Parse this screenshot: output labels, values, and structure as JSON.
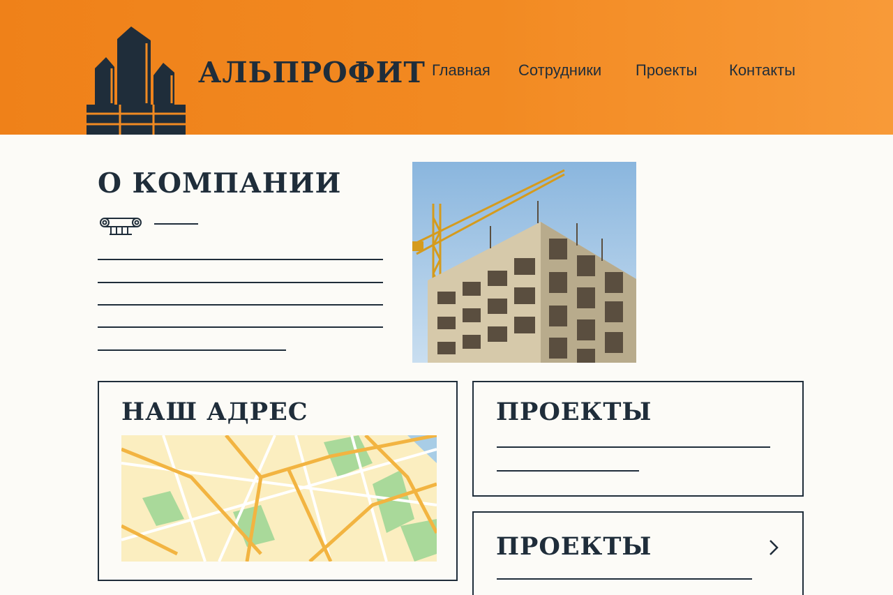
{
  "header": {
    "brand": "АЛЬПРОФИТ",
    "logo_icon": "buildings-logo-icon",
    "nav": [
      "Главная",
      "Сотрудники",
      "Проекты",
      "Контакты"
    ]
  },
  "about": {
    "title": "О КОМПАНИИ",
    "ornament_icon": "ionic-column-icon",
    "photo": "construction-site-crane-photo"
  },
  "address_card": {
    "title": "НАШ АДРЕС",
    "map": "street-map"
  },
  "projects_cards": [
    {
      "title": "ПРОЕКТЫ"
    },
    {
      "title": "ПРОЕКТЫ",
      "arrow_icon": "chevron-right-icon"
    }
  ],
  "colors": {
    "header_orange": "#ef8119",
    "header_orange_light": "#f89a38",
    "ink": "#1f2d3a",
    "page_bg": "#fcfbf7",
    "map_base": "#fbeec0",
    "map_road": "#f2b441",
    "map_green": "#a9d99a",
    "sky": "#8ab6de"
  }
}
